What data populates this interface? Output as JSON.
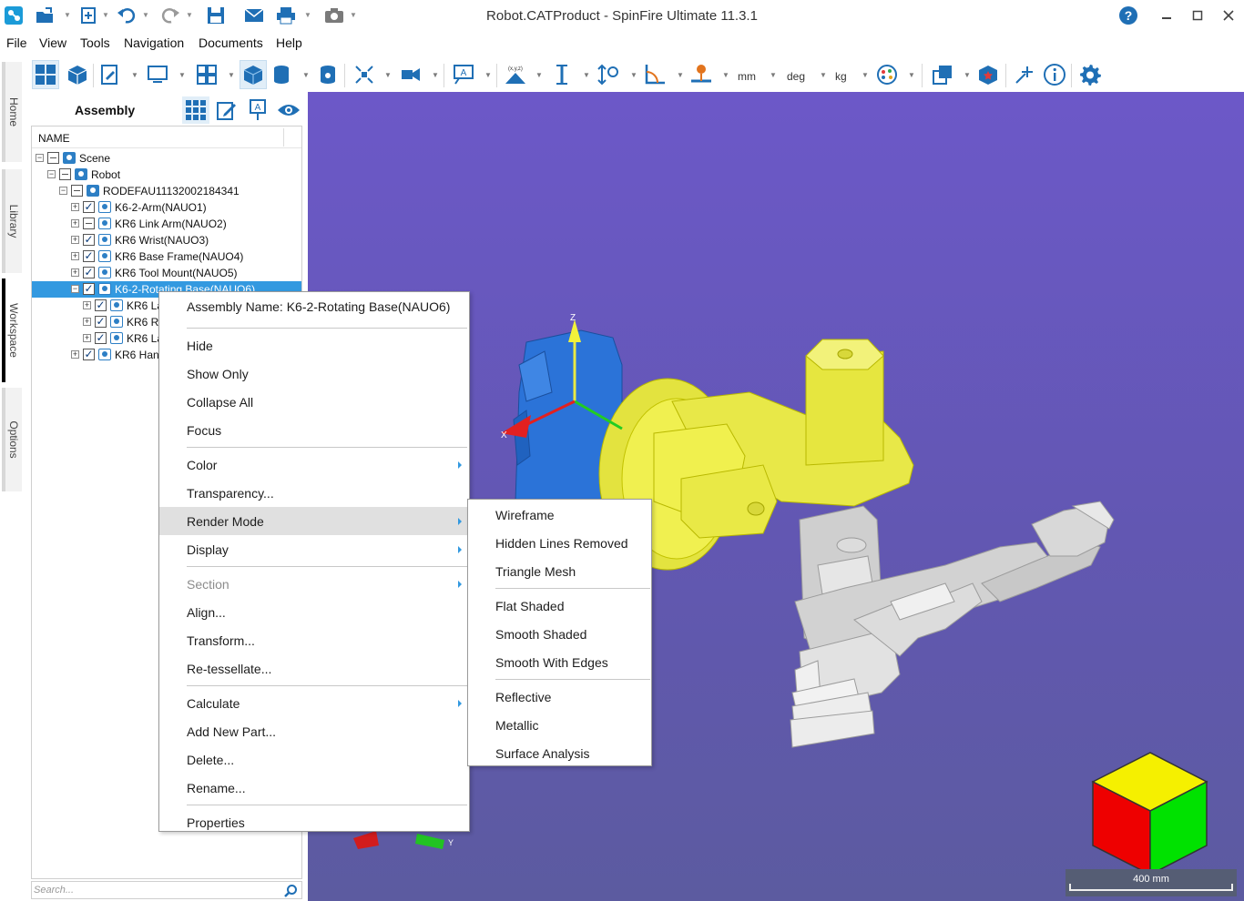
{
  "window": {
    "title": "Robot.CATProduct - SpinFire Ultimate 11.3.1"
  },
  "menubar": [
    "File",
    "View",
    "Tools",
    "Navigation",
    "Documents",
    "Help"
  ],
  "toolbar": {
    "units": {
      "length": "mm",
      "angle": "deg",
      "mass": "kg"
    }
  },
  "sidetabs": [
    "Home",
    "Library",
    "Workspace",
    "Options"
  ],
  "panel": {
    "title": "Assembly",
    "column_header": "NAME",
    "search_placeholder": "Search...",
    "tree": [
      {
        "label": "Scene",
        "level": 0,
        "checked": "partial",
        "expanded": true
      },
      {
        "label": "Robot",
        "level": 1,
        "checked": "partial",
        "expanded": true
      },
      {
        "label": "RODEFAU11132002184341",
        "level": 2,
        "checked": "partial",
        "expanded": true
      },
      {
        "label": "K6-2-Arm(NAUO1)",
        "level": 3,
        "checked": "yes",
        "expanded": false
      },
      {
        "label": "KR6 Link Arm(NAUO2)",
        "level": 3,
        "checked": "partial",
        "expanded": false
      },
      {
        "label": "KR6 Wrist(NAUO3)",
        "level": 3,
        "checked": "yes",
        "expanded": false
      },
      {
        "label": "KR6 Base Frame(NAUO4)",
        "level": 3,
        "checked": "yes",
        "expanded": false
      },
      {
        "label": "KR6 Tool Mount(NAUO5)",
        "level": 3,
        "checked": "yes",
        "expanded": false
      },
      {
        "label": "K6-2-Rotating Base(NAUO6)",
        "level": 3,
        "checked": "yes",
        "expanded": true,
        "selected": true
      },
      {
        "label": "KR6 La",
        "level": 4,
        "checked": "yes",
        "expanded": false
      },
      {
        "label": "KR6 Ro",
        "level": 4,
        "checked": "yes",
        "expanded": false
      },
      {
        "label": "KR6 La",
        "level": 4,
        "checked": "yes",
        "expanded": false
      },
      {
        "label": "KR6 Hand",
        "level": 3,
        "checked": "yes",
        "expanded": false
      }
    ]
  },
  "viewport": {
    "scale_label": "400 mm",
    "axes": {
      "x": "X",
      "y": "Y",
      "z": "Z"
    }
  },
  "context_menu": {
    "header": "Assembly Name: K6-2-Rotating Base(NAUO6)",
    "groups": [
      [
        {
          "label": "Hide"
        },
        {
          "label": "Show Only"
        },
        {
          "label": "Collapse All"
        },
        {
          "label": "Focus"
        }
      ],
      [
        {
          "label": "Color",
          "submenu": true
        },
        {
          "label": "Transparency..."
        },
        {
          "label": "Render Mode",
          "submenu": true,
          "hover": true
        },
        {
          "label": "Display",
          "submenu": true
        }
      ],
      [
        {
          "label": "Section",
          "submenu": true,
          "disabled": true
        },
        {
          "label": "Align..."
        },
        {
          "label": "Transform..."
        },
        {
          "label": "Re-tessellate..."
        }
      ],
      [
        {
          "label": "Calculate",
          "submenu": true
        },
        {
          "label": "Add New Part..."
        },
        {
          "label": "Delete..."
        },
        {
          "label": "Rename..."
        }
      ],
      [
        {
          "label": "Properties"
        }
      ]
    ]
  },
  "render_mode_submenu": [
    [
      "Wireframe",
      "Hidden Lines Removed",
      "Triangle Mesh"
    ],
    [
      "Flat Shaded",
      "Smooth Shaded",
      "Smooth With Edges"
    ],
    [
      "Reflective",
      "Metallic",
      "Surface Analysis"
    ]
  ],
  "colors": {
    "accent": "#3399e0",
    "viewport_top": "#6c58c8",
    "viewport_bottom": "#5c5ba0",
    "selected_part": "#e8e84a",
    "highlight_part": "#2a6fd6"
  }
}
